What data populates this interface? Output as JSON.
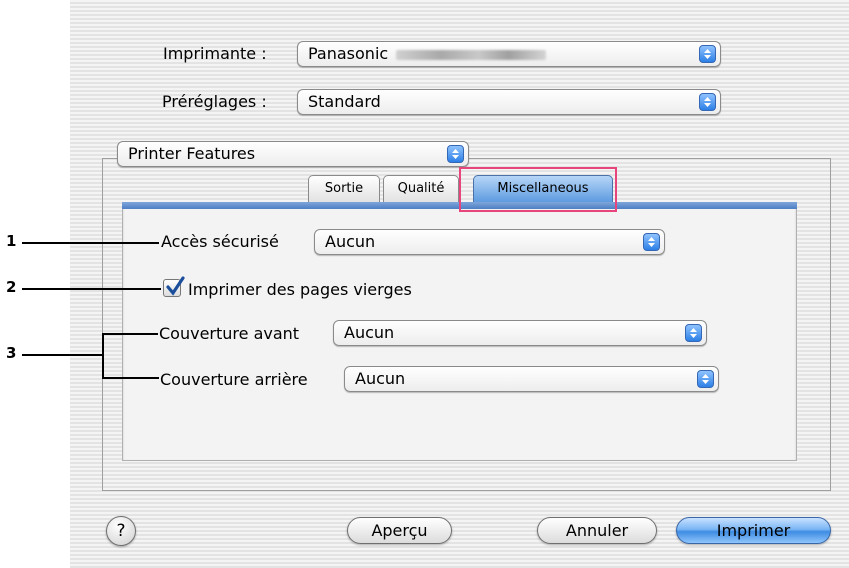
{
  "printer": {
    "label": "Imprimante :",
    "value": "Panasonic"
  },
  "presets": {
    "label": "Préréglages :",
    "value": "Standard"
  },
  "panel_select": {
    "value": "Printer Features"
  },
  "tabs": [
    {
      "label": "Sortie"
    },
    {
      "label": "Qualité"
    },
    {
      "label": "Miscellaneous"
    }
  ],
  "secure_access": {
    "label": "Accès sécurisé",
    "value": "Aucun"
  },
  "blank_pages": {
    "label": "Imprimer des pages vierges",
    "checked": true
  },
  "front_cover": {
    "label": "Couverture avant",
    "value": "Aucun"
  },
  "back_cover": {
    "label": "Couverture arrière",
    "value": "Aucun"
  },
  "buttons": {
    "help": "?",
    "preview": "Aperçu",
    "cancel": "Annuler",
    "print": "Imprimer"
  },
  "callouts": [
    "1",
    "2",
    "3"
  ],
  "colors": {
    "accent": "#3f8ce3",
    "highlight": "#e8457c"
  }
}
